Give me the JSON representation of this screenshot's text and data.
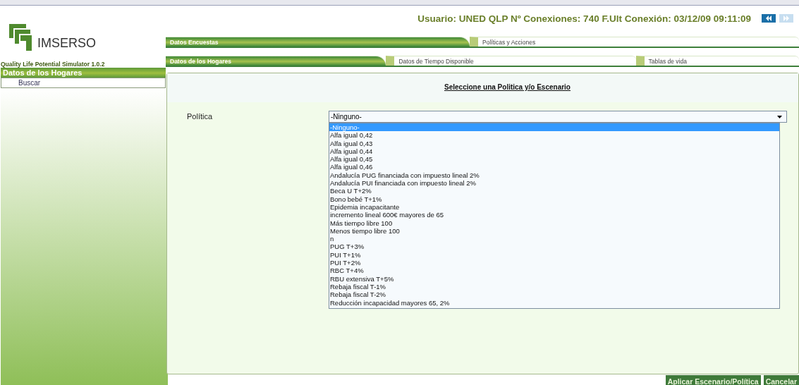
{
  "header": {
    "user_info": "Usuario: UNED QLP Nº Conexiones: 740 F.Ult Conexión: 03/12/09 09:11:09",
    "nav_buttons": [
      {
        "kind": "previous",
        "disabled": false
      },
      {
        "kind": "next",
        "disabled": true
      }
    ]
  },
  "logo": {
    "name": "IMSERSO",
    "subtitle": "Quality Life Potential Simulator 1.0.2"
  },
  "sidebar": {
    "title": "Datos de los Hogares",
    "items": [
      {
        "label": "Buscar"
      }
    ]
  },
  "tabs_primary": [
    {
      "label": "Datos Encuestas",
      "selected": true
    },
    {
      "label": "Políticas y Acciones",
      "selected": false
    }
  ],
  "tabs_secondary": [
    {
      "label": "Datos de los Hogares",
      "selected": true
    },
    {
      "label": "Datos de Tiempo Disponible",
      "selected": false
    },
    {
      "label": "Tablas de vida",
      "selected": false
    }
  ],
  "panel": {
    "title": "Seleccione una Politica y/o Escenario",
    "field_label": "Política",
    "select_value": "-Ninguno-",
    "options": [
      {
        "label": "-Ninguno-",
        "selected": true
      },
      {
        "label": "Alfa igual 0,42",
        "selected": false
      },
      {
        "label": "Alfa igual 0,43",
        "selected": false
      },
      {
        "label": "Alfa igual 0,44",
        "selected": false
      },
      {
        "label": "Alfa igual 0,45",
        "selected": false
      },
      {
        "label": "Alfa igual 0,46",
        "selected": false
      },
      {
        "label": "Andalucía PUG financiada con impuesto lineal 2%",
        "selected": false
      },
      {
        "label": "Andalucía PUI financiada con impuesto lineal 2%",
        "selected": false
      },
      {
        "label": "Beca U T+2%",
        "selected": false
      },
      {
        "label": "Bono bebé T+1%",
        "selected": false
      },
      {
        "label": "Epidemia incapacitante",
        "selected": false
      },
      {
        "label": "incremento lineal 600€ mayores de 65",
        "selected": false
      },
      {
        "label": "Más tiempo libre 100",
        "selected": false
      },
      {
        "label": "Menos tiempo libre 100",
        "selected": false
      },
      {
        "label": "n",
        "selected": false
      },
      {
        "label": "PUG T+3%",
        "selected": false
      },
      {
        "label": "PUI T+1%",
        "selected": false
      },
      {
        "label": "PUI T+2%",
        "selected": false
      },
      {
        "label": "RBC T+4%",
        "selected": false
      },
      {
        "label": "RBU extensiva T+5%",
        "selected": false
      },
      {
        "label": "Rebaja fiscal T-1%",
        "selected": false
      },
      {
        "label": "Rebaja fiscal T-2%",
        "selected": false
      },
      {
        "label": "Reducción incapacidad mayores 65, 2%",
        "selected": false
      }
    ]
  },
  "buttons": [
    "Aplicar Escenario/Política",
    "Cancelar"
  ]
}
